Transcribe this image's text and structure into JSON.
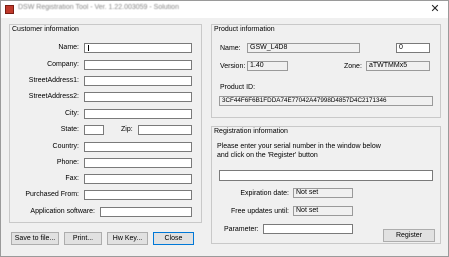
{
  "window": {
    "title": "DSW Registration Tool - Ver. 1.22.003059 - Solution",
    "close_glyph": "✕"
  },
  "customer": {
    "title": "Customer information",
    "fields": [
      {
        "label": "Name:",
        "value": ""
      },
      {
        "label": "Company:",
        "value": ""
      },
      {
        "label": "StreetAddress1:",
        "value": ""
      },
      {
        "label": "StreetAddress2:",
        "value": ""
      },
      {
        "label": "City:",
        "value": ""
      },
      {
        "label": "Country:",
        "value": ""
      },
      {
        "label": "Phone:",
        "value": ""
      },
      {
        "label": "Fax:",
        "value": ""
      },
      {
        "label": "Purchased From:",
        "value": ""
      },
      {
        "label": "Application software:",
        "value": ""
      }
    ],
    "state": {
      "label": "State:",
      "value": ""
    },
    "zip": {
      "label": "Zip:",
      "value": ""
    }
  },
  "product": {
    "title": "Product information",
    "name_label": "Name:",
    "name_value": "GSW_L4D8",
    "count_value": "0",
    "version_label": "Version:",
    "version_value": "1.40",
    "zone_label": "Zone:",
    "zone_value": "aTWTMMx5",
    "id_label": "Product ID:",
    "id_value": "3CF44F6F6B1FDDA74E77042A47998D4857D4C2171346"
  },
  "registration": {
    "title": "Registration information",
    "instructions_line1": "Please enter your serial number in the window below",
    "instructions_line2": "and click on the 'Register' button",
    "serial_value": "",
    "expiration_label": "Expiration date:",
    "expiration_value": "Not set",
    "updates_label": "Free updates until:",
    "updates_value": "Not set",
    "parameter_label": "Parameter:",
    "parameter_value": "",
    "register_button": "Register"
  },
  "buttons": {
    "save": "Save to file...",
    "print": "Print...",
    "hwkey": "Hw Key...",
    "close": "Close"
  }
}
